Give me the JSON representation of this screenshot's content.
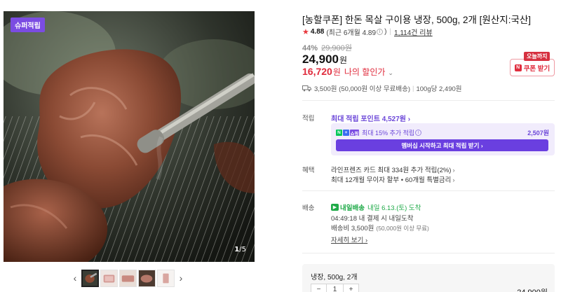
{
  "gallery": {
    "badge": "슈퍼적립",
    "counter_current": "1",
    "counter_total": "/5",
    "thumb_count": 5
  },
  "product": {
    "title": "[농할쿠폰] 한돈 목살 구이용 냉장, 500g, 2개 [원산지:국산]",
    "rating": "4.88",
    "rating_recent": "(최근 6개월 4.89",
    "rating_recent_close": ")",
    "review_count": "1,114건 리뷰",
    "discount_rate": "44%",
    "original_price": "29,900원",
    "sale_price": "24,900",
    "sale_unit": "원",
    "my_price": "16,720",
    "my_price_unit": "원",
    "my_price_label": "나의 할인가",
    "today_badge": "오늘까지",
    "coupon_label": "쿠폰 받기",
    "shipping_fee": "3,500원 (50,000원 이상 무료배송)",
    "unit_price": "100g당 2,490원"
  },
  "points": {
    "label": "적립",
    "max_points": "최대 적립 포인트 4,527원",
    "np_badge": [
      "N",
      "+",
      "쇼핑"
    ],
    "extra_text": "최대 15% 추가 적립",
    "extra_amount": "2,507원",
    "member_button": "멤버십 시작하고 최대 적립 받기"
  },
  "benefits": {
    "label": "혜택",
    "line1": "라인프렌즈 카드 최대 334원 추가 적립(2%)",
    "line2": "최대 12개월 무이자 할부 • 60개월 특별금리"
  },
  "delivery": {
    "label": "배송",
    "badge": "내일배송",
    "date": "내일 6.13.(토) 도착",
    "time_line": "04:49:18  내 결제 시 내일도착",
    "fee": "배송비 3,500원",
    "fee_note": "(50,000원 이상 무료)",
    "detail_link": "자세히 보기"
  },
  "option": {
    "name": "냉장, 500g, 2개",
    "quantity": "1",
    "price": "24,900원"
  },
  "colors": {
    "accent_red": "#e02c3d",
    "accent_purple": "#6a3fe0",
    "delivery_green": "#1faa48"
  }
}
